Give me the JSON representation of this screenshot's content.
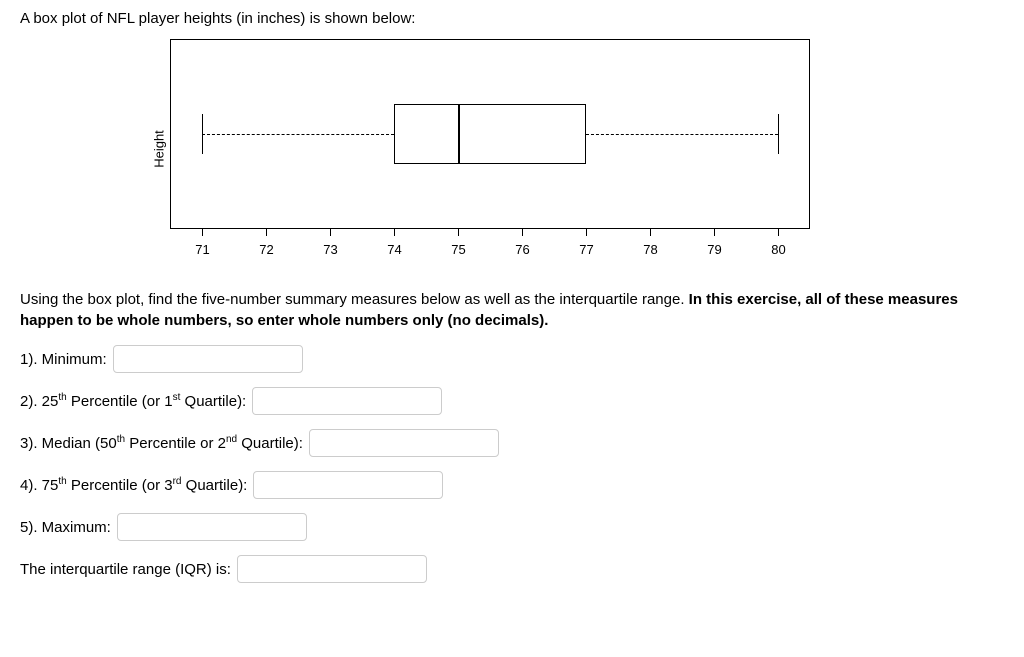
{
  "intro": "A box plot of NFL player heights (in inches) is shown below:",
  "chart_data": {
    "type": "boxplot",
    "ylabel": "Height",
    "axis_min": 70.5,
    "axis_max": 80.5,
    "ticks": [
      71,
      72,
      73,
      74,
      75,
      76,
      77,
      78,
      79,
      80
    ],
    "min": 71,
    "q1": 74,
    "median": 75,
    "q3": 77,
    "max": 80,
    "iqr": 3
  },
  "instructions_plain": "Using the box plot, find the five-number summary measures below as well as the interquartile range. ",
  "instructions_bold": "In this exercise, all of these measures happen to be whole numbers, so enter whole numbers only (no decimals).",
  "questions": {
    "q1_label": "1). Minimum:",
    "q2_prefix": "2). 25",
    "q2_sup1": "th",
    "q2_mid": " Percentile (or 1",
    "q2_sup2": "st",
    "q2_suffix": " Quartile):",
    "q3_prefix": "3). Median (50",
    "q3_sup1": "th",
    "q3_mid": " Percentile or 2",
    "q3_sup2": "nd",
    "q3_suffix": " Quartile):",
    "q4_prefix": "4). 75",
    "q4_sup1": "th",
    "q4_mid": " Percentile (or 3",
    "q4_sup2": "rd",
    "q4_suffix": " Quartile):",
    "q5_label": "5). Maximum:",
    "iqr_label": "The interquartile range (IQR) is:"
  }
}
